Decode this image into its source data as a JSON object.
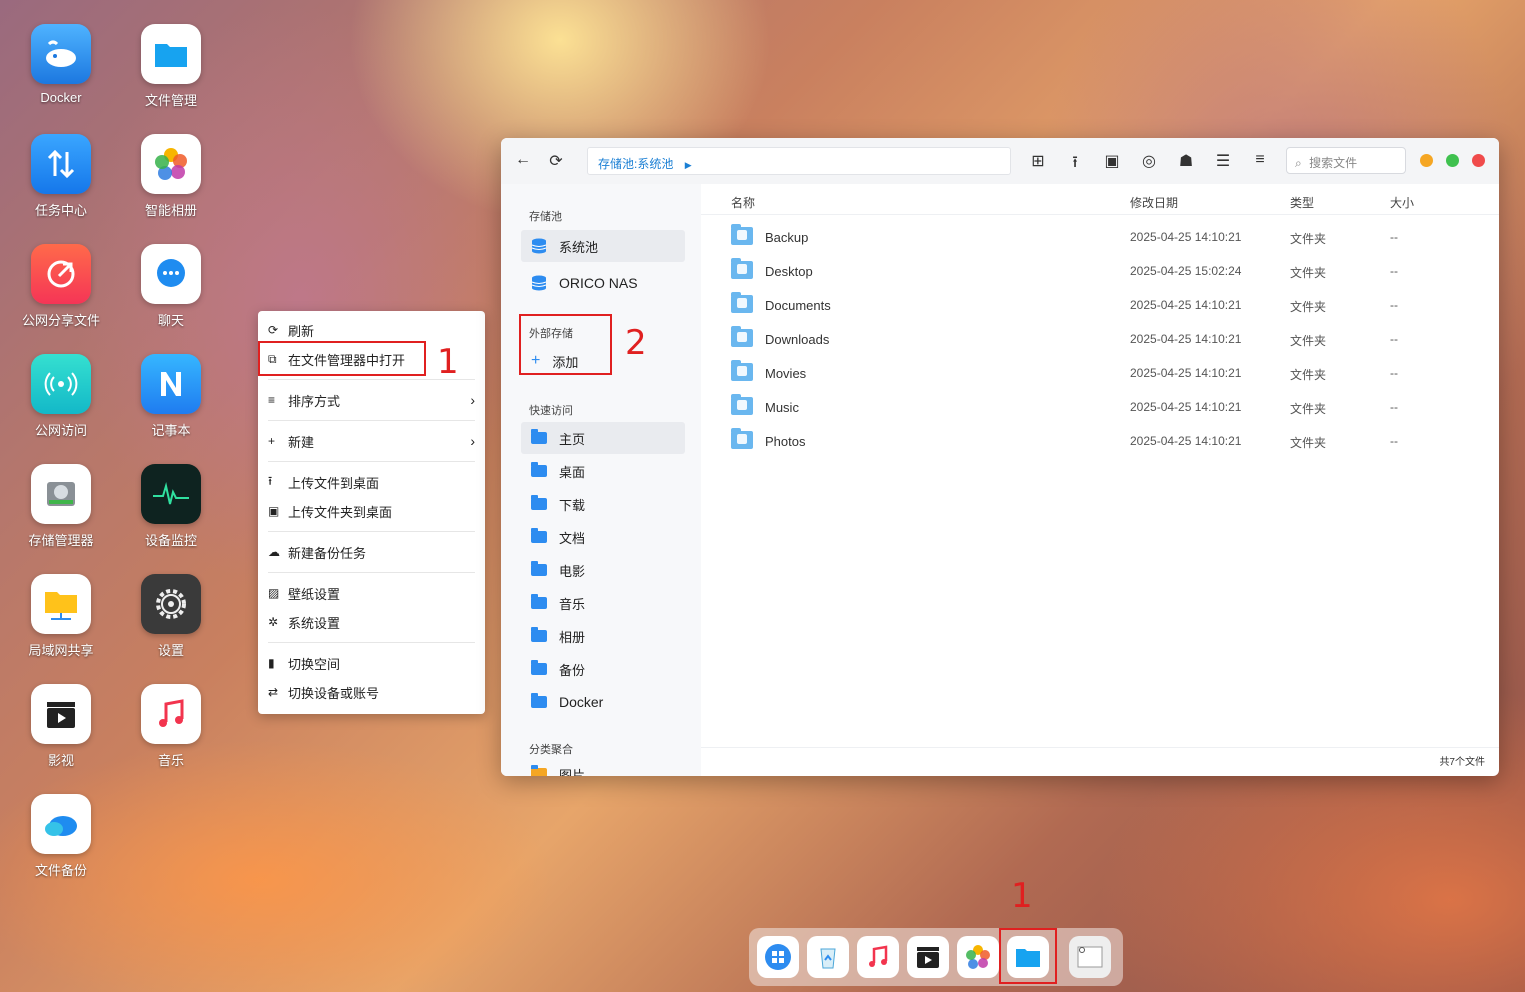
{
  "desktop_icons": [
    {
      "label": "Docker"
    },
    {
      "label": "文件管理"
    },
    {
      "label": "任务中心"
    },
    {
      "label": "智能相册"
    },
    {
      "label": "公网分享文件"
    },
    {
      "label": "聊天"
    },
    {
      "label": "公网访问"
    },
    {
      "label": "记事本"
    },
    {
      "label": "存储管理器"
    },
    {
      "label": "设备监控"
    },
    {
      "label": "局域网共享"
    },
    {
      "label": "设置"
    },
    {
      "label": "影视"
    },
    {
      "label": "音乐"
    },
    {
      "label": "文件备份"
    }
  ],
  "context_menu": {
    "refresh": "刷新",
    "open_in_fm": "在文件管理器中打开",
    "sort": "排序方式",
    "new": "新建",
    "upload_file": "上传文件到桌面",
    "upload_folder": "上传文件夹到桌面",
    "backup_task": "新建备份任务",
    "wallpaper": "壁纸设置",
    "system_settings": "系统设置",
    "switch_space": "切换空间",
    "switch_device": "切换设备或账号"
  },
  "annotations": {
    "one": "1",
    "two": "2",
    "dock_one": "1"
  },
  "window": {
    "path": "存储池:系统池",
    "search_placeholder": "搜索文件",
    "sidebar": {
      "pool_header": "存储池",
      "pools": [
        "系统池",
        "ORICO NAS"
      ],
      "external_header": "外部存储",
      "add": "添加",
      "quick_header": "快速访问",
      "quick": [
        "主页",
        "桌面",
        "下载",
        "文档",
        "电影",
        "音乐",
        "相册",
        "备份",
        "Docker"
      ],
      "category_header": "分类聚合",
      "category_partial": "图片"
    },
    "columns": {
      "name": "名称",
      "date": "修改日期",
      "type": "类型",
      "size": "大小"
    },
    "rows": [
      {
        "name": "Backup",
        "date": "2025-04-25 14:10:21",
        "type": "文件夹",
        "size": "--"
      },
      {
        "name": "Desktop",
        "date": "2025-04-25 15:02:24",
        "type": "文件夹",
        "size": "--"
      },
      {
        "name": "Documents",
        "date": "2025-04-25 14:10:21",
        "type": "文件夹",
        "size": "--"
      },
      {
        "name": "Downloads",
        "date": "2025-04-25 14:10:21",
        "type": "文件夹",
        "size": "--"
      },
      {
        "name": "Movies",
        "date": "2025-04-25 14:10:21",
        "type": "文件夹",
        "size": "--"
      },
      {
        "name": "Music",
        "date": "2025-04-25 14:10:21",
        "type": "文件夹",
        "size": "--"
      },
      {
        "name": "Photos",
        "date": "2025-04-25 14:10:21",
        "type": "文件夹",
        "size": "--"
      }
    ],
    "footer": "共7个文件"
  },
  "colors": {
    "accent": "#2d8cf0",
    "annotation_red": "#e02020",
    "win_orange": "#f5a623",
    "win_green": "#3fc14f",
    "win_red": "#f04b4b"
  }
}
